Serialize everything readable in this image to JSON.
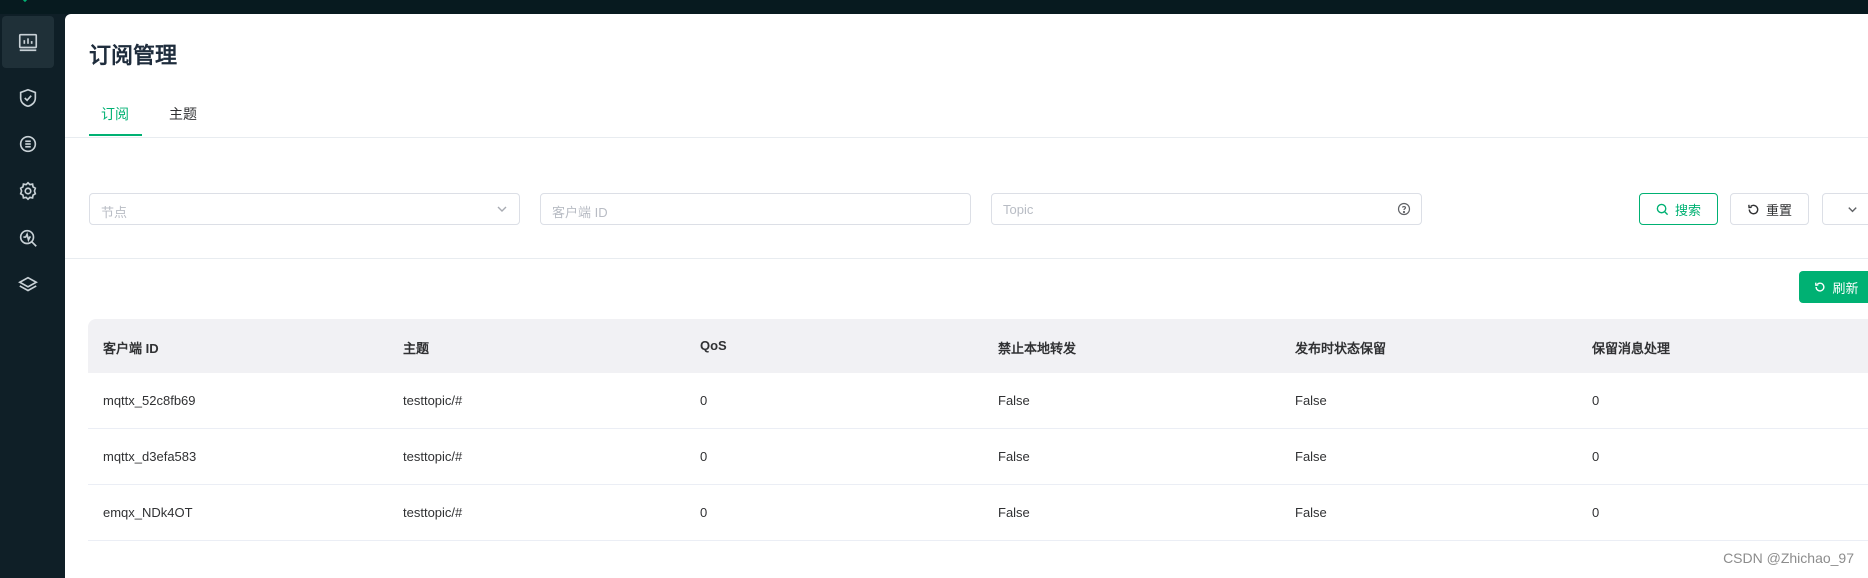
{
  "header": {
    "title": "订阅管理"
  },
  "tabs": [
    {
      "label": "订阅",
      "active": true
    },
    {
      "label": "主题",
      "active": false
    }
  ],
  "filters": {
    "node_placeholder": "节点",
    "client_id_placeholder": "客户端 ID",
    "topic_placeholder": "Topic"
  },
  "actions": {
    "search_label": "搜索",
    "reset_label": "重置",
    "refresh_label": "刷新"
  },
  "sidebar": {
    "items": [
      {
        "icon": "dashboard-icon",
        "active": true
      },
      {
        "icon": "shield-icon",
        "active": false
      },
      {
        "icon": "integration-icon",
        "active": false
      },
      {
        "icon": "settings-icon",
        "active": false
      },
      {
        "icon": "diagnose-icon",
        "active": false
      },
      {
        "icon": "layers-icon",
        "active": false
      }
    ]
  },
  "table": {
    "columns": [
      "客户端 ID",
      "主题",
      "QoS",
      "禁止本地转发",
      "发布时状态保留",
      "保留消息处理"
    ],
    "rows": [
      [
        "mqttx_52c8fb69",
        "testtopic/#",
        "0",
        "False",
        "False",
        "0"
      ],
      [
        "mqttx_d3efa583",
        "testtopic/#",
        "0",
        "False",
        "False",
        "0"
      ],
      [
        "emqx_NDk4OT",
        "testtopic/#",
        "0",
        "False",
        "False",
        "0"
      ]
    ]
  },
  "watermark": "CSDN @Zhichao_97",
  "colors": {
    "accent": "#00b173",
    "sidebar_bg": "#0f1f27",
    "header_bg": "#f1f1f4"
  }
}
